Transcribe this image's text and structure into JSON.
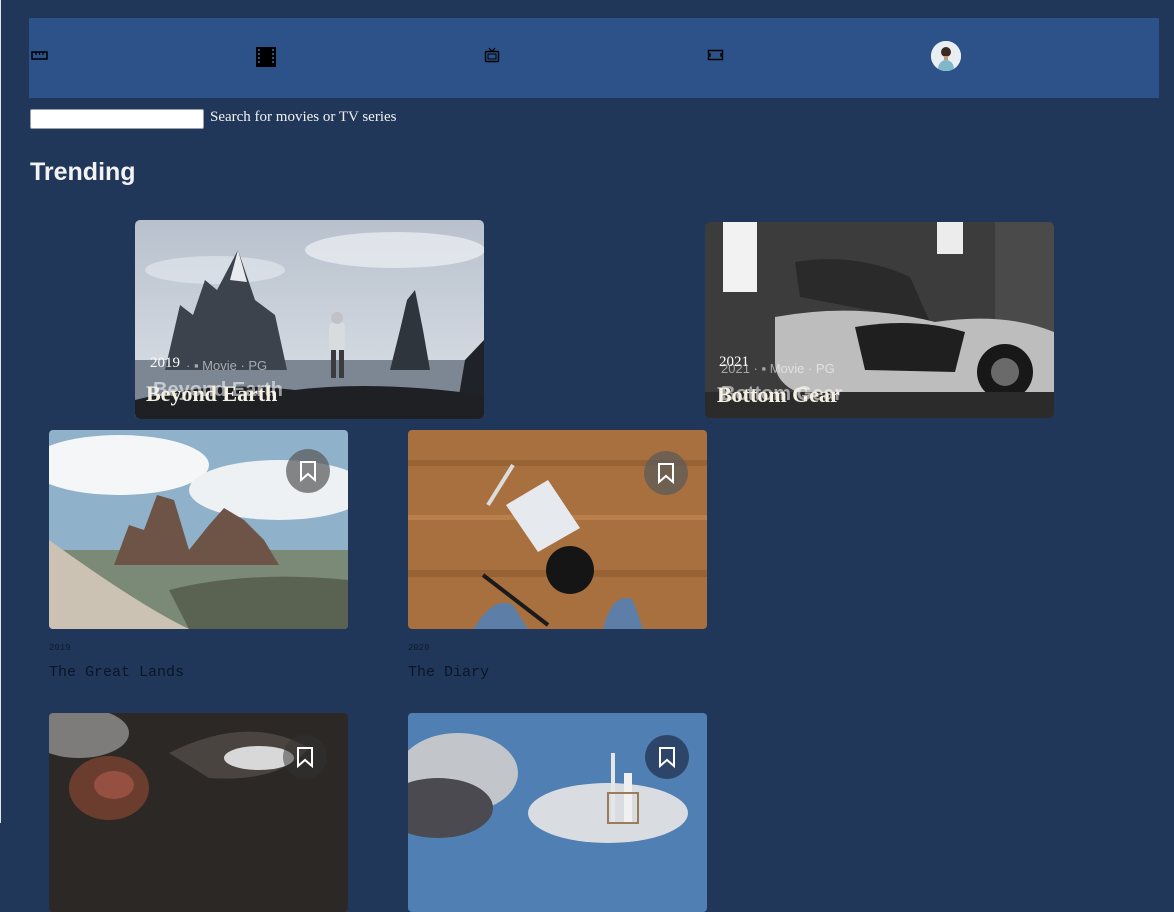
{
  "nav": {
    "icons": [
      "home-icon",
      "movies-icon",
      "tv-series-icon",
      "bookmark-nav-icon"
    ],
    "avatar": "user-avatar"
  },
  "search": {
    "value": "",
    "label": "Search for movies or TV series"
  },
  "trending": {
    "heading": "Trending",
    "items": [
      {
        "year": "2019",
        "meta": "· ▪ Movie · PG",
        "title": "Beyond Earth",
        "ghost_title": "Beyond Earth"
      },
      {
        "year": "2021",
        "meta": "2021 · ▪ Movie · PG",
        "title": "Bottom Gear",
        "ghost_title": "Bottom Gear"
      }
    ]
  },
  "recommended": {
    "items": [
      {
        "year": "2019",
        "title": "The Great Lands"
      },
      {
        "year": "2020",
        "title": "The Diary"
      },
      {
        "year": "",
        "title": ""
      },
      {
        "year": "",
        "title": ""
      }
    ]
  },
  "colors": {
    "background": "#20375a",
    "navbar": "#2c5289",
    "text_light": "#f2f2f2"
  }
}
